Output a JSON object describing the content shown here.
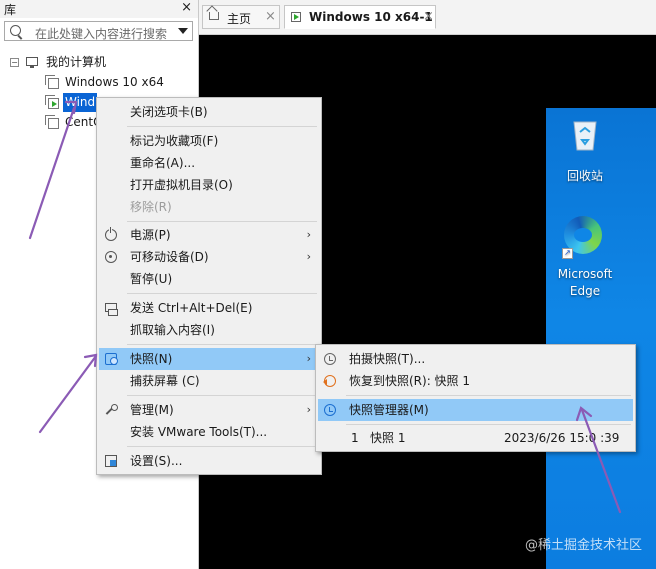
{
  "library": {
    "title": "库",
    "close_glyph": "×",
    "search_placeholder": "在此处键入内容进行搜索",
    "tree": {
      "root_label": "我的计算机",
      "root_expander": "−",
      "items": [
        {
          "label": "Windows 10 x64"
        },
        {
          "label": "Wind",
          "selected": true
        },
        {
          "label": "CentOS"
        }
      ]
    }
  },
  "tabs": [
    {
      "label": "主页",
      "icon": "home-icon",
      "close": "×"
    },
    {
      "label": "Windows 10 x64-1",
      "icon": "vm-icon",
      "close": "×",
      "active": true
    }
  ],
  "desktop": {
    "recycle_bin": "回收站",
    "edge_line1": "Microsoft",
    "edge_line2": "Edge",
    "shortcut_glyph": "↗"
  },
  "context_menu": {
    "items": [
      {
        "label": "关闭选项卡(B)"
      },
      {
        "label": "标记为收藏项(F)"
      },
      {
        "label": "重命名(A)..."
      },
      {
        "label": "打开虚拟机目录(O)"
      },
      {
        "label": "移除(R)",
        "disabled": true
      },
      {
        "label": "电源(P)",
        "icon": "power-icon",
        "submenu": true
      },
      {
        "label": "可移动设备(D)",
        "icon": "removable-device-icon",
        "submenu": true
      },
      {
        "label": "暂停(U)"
      },
      {
        "label": "发送 Ctrl+Alt+Del(E)",
        "icon": "send-keys-icon"
      },
      {
        "label": "抓取输入内容(I)"
      },
      {
        "label": "快照(N)",
        "icon": "snapshot-icon",
        "submenu": true,
        "highlighted": true
      },
      {
        "label": "捕获屏幕 (C)"
      },
      {
        "label": "管理(M)",
        "icon": "wrench-icon",
        "submenu": true
      },
      {
        "label": "安装 VMware Tools(T)..."
      },
      {
        "label": "设置(S)...",
        "icon": "settings-icon"
      }
    ],
    "submenu_arrow": "›"
  },
  "snapshot_menu": {
    "take": "拍摄快照(T)...",
    "revert": "恢复到快照(R): 快照 1",
    "manager": "快照管理器(M)",
    "entry": {
      "index": "1",
      "name": "快照 1",
      "date": "2023/6/26 15:0 :39"
    }
  },
  "watermark": "@稀土掘金技术社区",
  "colors": {
    "highlight": "#91c9f7",
    "selection": "#0a64d4",
    "desktop": "#0f86e6",
    "arrow": "#8b5bb5"
  }
}
